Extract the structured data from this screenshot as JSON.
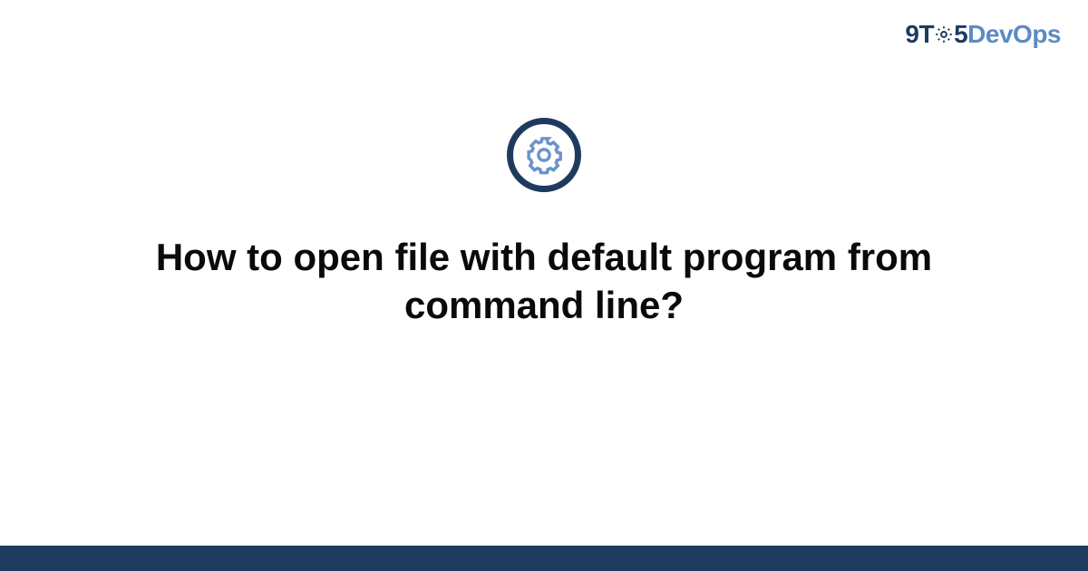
{
  "logo": {
    "part1": "9T",
    "part2": "5",
    "part3": "DevOps"
  },
  "title": "How to open file with default program from command line?",
  "colors": {
    "brand_dark": "#1e3a5f",
    "brand_light": "#5b8bc4"
  }
}
